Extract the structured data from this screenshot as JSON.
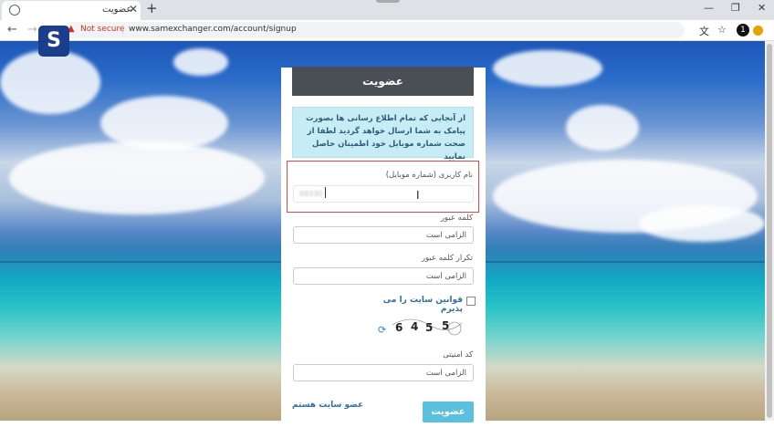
{
  "browser": {
    "tab_title": "عضویت",
    "tab_close": "✕",
    "new_tab": "+",
    "window_controls": [
      "—",
      "❐",
      "✕"
    ],
    "nav": {
      "back": "←",
      "forward": "→",
      "reload": "C"
    },
    "security_label": "Not secure",
    "url": "www.samexchanger.com/account/signup",
    "extension_badge": "1"
  },
  "site": {
    "logo_letter": "S"
  },
  "form": {
    "header": "عضویت",
    "info_text": "از آنجایی که تمام اطلاع رسانی ها بصورت پیامک به شما ارسال خواهد گردید لطفا از صحت شماره موبایل خود اطمینان حاصل نمایید",
    "username_label": "نام کاربری (شماره موبایل)",
    "username_value": "09330",
    "password_label": "کلمه عبور",
    "password_placeholder": "الزامی است",
    "confirm_label": "تکرار کلمه عبور",
    "confirm_placeholder": "الزامی است",
    "terms_label": "قوانین سایت را می پذیرم",
    "captcha_chars": [
      "6",
      "4",
      "5",
      "5"
    ],
    "security_code_label": "کد امنیتی",
    "security_code_placeholder": "الزامی است",
    "submit_label": "عضویت",
    "member_link": "عضو سایت هستم"
  }
}
